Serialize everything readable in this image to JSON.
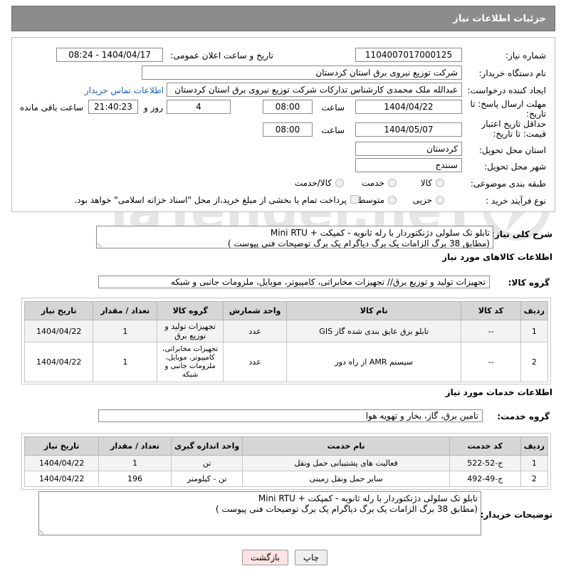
{
  "header": {
    "title": "جزئیات اطلاعات نیاز"
  },
  "form": {
    "need_number_label": "شماره نیاز:",
    "need_number": "1104007017000125",
    "announce_label": "تاریخ و ساعت اعلان عمومی:",
    "announce_value": "1404/04/17 - 08:24",
    "buyer_org_label": "نام دستگاه خریدار:",
    "buyer_org": "شرکت توزیع نیروی برق استان کردستان",
    "requester_label": "ایجاد کننده درخواست:",
    "requester": "عبدالله ملک محمدی کارشناس تدارکات شرکت توزیع نیروی برق استان کردستان",
    "contact_link": "اطلاعات تماس خریدار",
    "deadline_label": "مهلت ارسال پاسخ: تا تاریخ:",
    "deadline_date": "1404/04/22",
    "time_label": "ساعت",
    "deadline_time": "08:00",
    "days_value": "4",
    "days_label": "روز و",
    "remaining_time": "21:40:23",
    "remaining_label": "ساعت باقی مانده",
    "min_price_label": "حداقل تاریخ اعتبار قیمت: تا تاریخ:",
    "min_price_date": "1404/05/07",
    "min_price_time": "08:00",
    "province_label": "استان محل تحویل:",
    "province": "کردستان",
    "city_label": "شهر محل تحویل:",
    "city": "سنندج",
    "category_label": "طبقه بندی موضوعی:",
    "category_options": [
      "کالا",
      "خدمت",
      "کالا/خدمت"
    ],
    "process_label": "نوع فرآیند خرید :",
    "process_options": [
      "جزیی",
      "متوسط"
    ],
    "payment_note": "پرداخت تمام یا بخشی از مبلغ خرید،از محل \"اسناد خزانه اسلامی\" خواهد بود."
  },
  "summary": {
    "label": "شرح کلی نیاز:",
    "line1": "تابلو تک سلولی دژنکتوردار با رله ثانویه - کمپکت + Mini RTU",
    "line2": "(مطابق 38 برگ الزامات یک برگ دیاگرام یک برگ توضیحات فنی پیوست )"
  },
  "goods": {
    "section_title": "اطلاعات کالاهای مورد نیاز",
    "group_label": "گروه کالا:",
    "group_value": "تجهیزات تولید و توزیع برق// تجهیزات مخابراتی، کامپیوتر، موبایل، ملزومات جانبی و شبکه",
    "columns": [
      "ردیف",
      "کد کالا",
      "نام کالا",
      "واحد شمارش",
      "گروه کالا",
      "تعداد / مقدار",
      "تاریخ نیاز"
    ],
    "rows": [
      {
        "row": "1",
        "code": "--",
        "name": "تابلو برق عایق بندی شده گاز GIS",
        "unit": "عدد",
        "group": "تجهیزات تولید و توزیع برق",
        "qty": "1",
        "date": "1404/04/22"
      },
      {
        "row": "2",
        "code": "--",
        "name": "سیستم AMR از راه دور",
        "unit": "عدد",
        "group": "تجهیزات مخابراتی، کامپیوتر، موبایل، ملزومات جانبی و شبکه",
        "qty": "1",
        "date": "1404/04/22"
      }
    ]
  },
  "services": {
    "section_title": "اطلاعات خدمات مورد نیاز",
    "group_label": "گروه خدمت:",
    "group_value": "تامین برق، گاز، بخار و تهویه هوا",
    "columns": [
      "ردیف",
      "کد خدمت",
      "نام خدمت",
      "واحد اندازه گیری",
      "تعداد / مقدار",
      "تاریخ نیاز"
    ],
    "rows": [
      {
        "row": "1",
        "code": "ج-52-522",
        "name": "فعالیت های پشتیبانی حمل ونقل",
        "unit": "تن",
        "qty": "1",
        "date": "1404/04/22"
      },
      {
        "row": "2",
        "code": "ج-49-492",
        "name": "سایر حمل ونقل زمینی",
        "unit": "تن - کیلومتر",
        "qty": "196",
        "date": "1404/04/22"
      }
    ]
  },
  "buyer_notes": {
    "label": "توضیحات خریدار:",
    "line1": "تابلو تک سلولی دژنکتوردار با رله ثانویه - کمپکت + Mini RTU",
    "line2": "(مطابق 38 برگ الزامات یک برگ دیاگرام یک برگ توضیحات فنی پیوست )"
  },
  "buttons": {
    "print": "چاپ",
    "back": "بازگشت"
  },
  "watermark_text": "AriaTender.neT",
  "colors": {
    "header_bg": "#8c8c8c",
    "link": "#1a61c4",
    "back_button_bg": "#fde3e3",
    "table_header_bg": "#d6d6d6"
  }
}
